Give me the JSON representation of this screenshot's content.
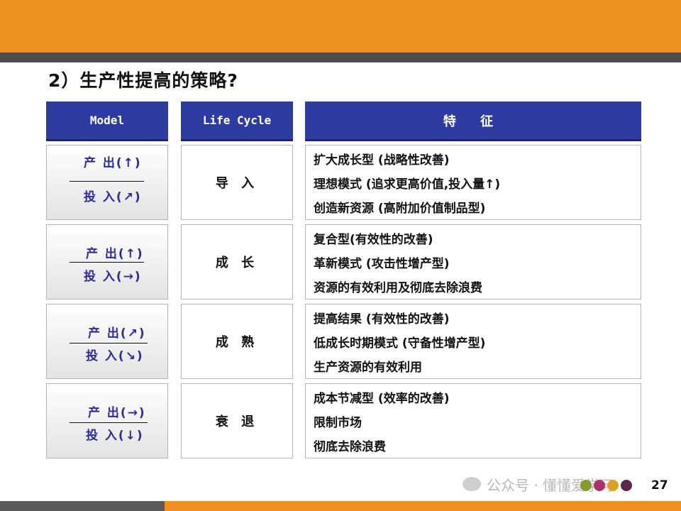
{
  "title": "2）生产性提高的策略?",
  "headers": {
    "model": "Model",
    "life_cycle": "Life Cycle",
    "features": "特  征"
  },
  "rows": [
    {
      "output": "产 出(↑)",
      "input": "投 入(↗)",
      "stage": "导 入",
      "features": [
        "扩大成长型 (战略性改善)",
        "理想模式 (追求更高价值,投入量↑)",
        "创造新资源 (高附加价值制品型)"
      ]
    },
    {
      "output": "产 出(↑)",
      "input": "投 入(→)",
      "stage": "成 长",
      "features": [
        "复合型(有效性的改善)",
        "革新模式 (攻击性增产型)",
        "资源的有效利用及彻底去除浪费"
      ]
    },
    {
      "output": "产 出(↗)",
      "input": "投 入(↘)",
      "stage": "成 熟",
      "features": [
        "提高结果 (有效性的改善)",
        "低成长时期模式 (守备性增产型)",
        "生产资源的有效利用"
      ]
    },
    {
      "output": "产 出(→)",
      "input": "投 入(↓)",
      "stage": "衰 退",
      "features": [
        "成本节减型 (效率的改善)",
        "限制市场",
        "彻底去除浪费"
      ]
    }
  ],
  "watermark": "公众号 · 懂懂爱学习",
  "page_number": "27",
  "colors": {
    "accent_orange": "#ee9020",
    "header_blue": "#2e3ba0",
    "ratio_text": "#2a2aa0",
    "dots": [
      "#8a9a2a",
      "#b0306a",
      "#e0a020",
      "#5a2a4a"
    ]
  }
}
